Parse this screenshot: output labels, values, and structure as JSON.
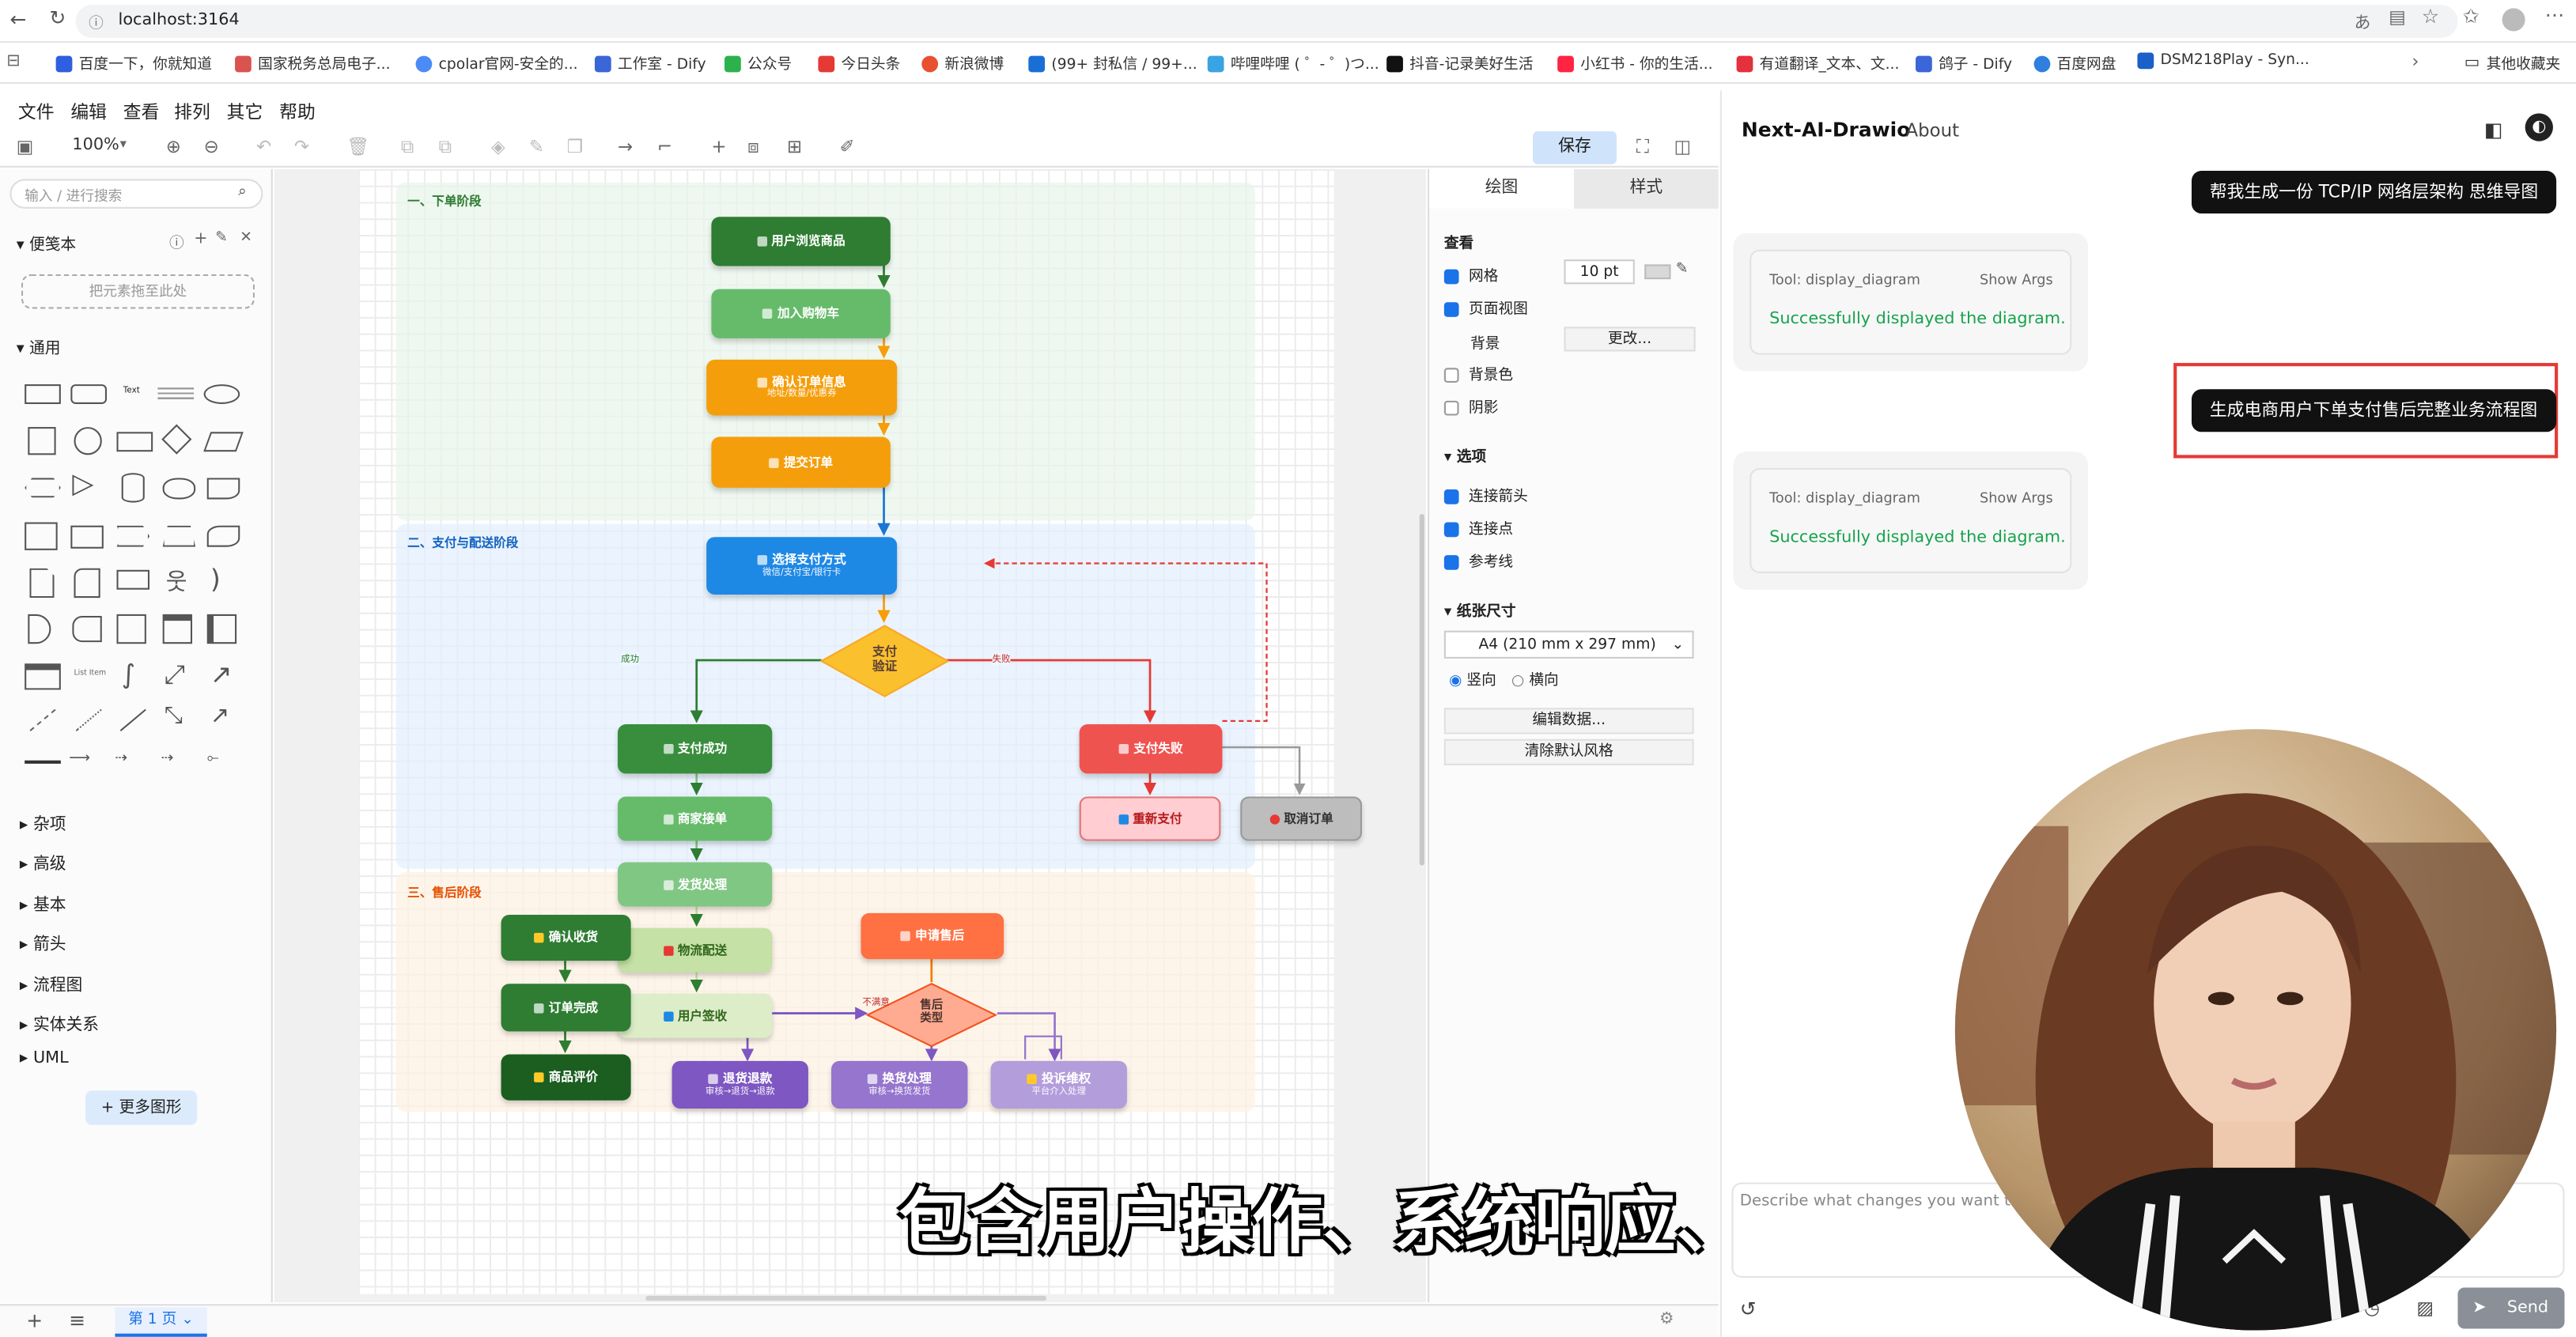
{
  "browser": {
    "url": "localhost:3164",
    "bookmarks": [
      "百度一下，你就知道",
      "国家税务总局电子...",
      "cpolar官网-安全的...",
      "工作室 - Dify",
      "公众号",
      "今日头条",
      "新浪微博",
      "(99+ 封私信 / 99+...",
      "哔哩哔哩 ( ゜- ゜)つ...",
      "抖音-记录美好生活",
      "小红书 - 你的生活...",
      "有道翻译_文本、文...",
      "鸽子 - Dify",
      "百度网盘",
      "DSM218Play - Syn..."
    ],
    "other_bookmarks": "其他收藏夹"
  },
  "menu": [
    "文件",
    "编辑",
    "查看",
    "排列",
    "其它",
    "帮助"
  ],
  "toolbar": {
    "zoom": "100%",
    "save": "保存"
  },
  "left": {
    "search_placeholder": "输入 / 进行搜索",
    "scratchpad": "便笺本",
    "drop_hint": "把元素拖至此处",
    "general": "通用",
    "sections": [
      "杂项",
      "高级",
      "基本",
      "箭头",
      "流程图",
      "实体关系",
      "UML"
    ],
    "more_shapes": "+ 更多图形"
  },
  "right": {
    "tabs": [
      "绘图",
      "样式"
    ],
    "view": "查看",
    "grid": "网格",
    "grid_size": "10 pt",
    "page_view": "页面视图",
    "background": "背景",
    "change": "更改...",
    "bg_color": "背景色",
    "shadow": "阴影",
    "options": "选项",
    "connection_arrows": "连接箭头",
    "connection_points": "连接点",
    "guides": "参考线",
    "paper_size": "纸张尺寸",
    "paper": "A4 (210 mm x 297 mm)",
    "portrait": "竖向",
    "landscape": "横向",
    "edit_data": "编辑数据...",
    "clear_style": "清除默认风格"
  },
  "bottom": {
    "page": "第 1 页"
  },
  "diagram": {
    "sec1": "一、下单阶段",
    "sec2": "二、支付与配送阶段",
    "sec3": "三、售后阶段",
    "browse": "用户浏览商品",
    "cart": "加入购物车",
    "confirm": "确认订单信息",
    "confirm_sub": "地址/数量/优惠券",
    "submit": "提交订单",
    "paymethod": "选择支付方式",
    "paymethod_sub": "微信/支付宝/银行卡",
    "payverify": "支付\n验证",
    "success_lbl": "成功",
    "fail_lbl": "失败",
    "pay_ok": "支付成功",
    "pay_fail": "支付失败",
    "repay": "重新支付",
    "cancel": "取消订单",
    "merchant": "商家接单",
    "ship": "发货处理",
    "logistics": "物流配送",
    "sign": "用户签收",
    "confirm_recv": "确认收货",
    "order_done": "订单完成",
    "review": "商品评价",
    "apply_as": "申请售后",
    "as_type": "售后\n类型",
    "unsatisfied": "不满意",
    "refund": "退货退款",
    "refund_sub": "审核→退货→退款",
    "exchange": "换货处理",
    "exchange_sub": "审核→换货发货",
    "complaint": "投诉维权",
    "complaint_sub": "平台介入处理"
  },
  "chat": {
    "title": "Next-AI-Drawio",
    "about": "About",
    "msg1": "帮我生成一份 TCP/IP 网络层架构 思维导图",
    "tool_name": "Tool: display_diagram",
    "show_args": "Show Args",
    "tool_result": "Successfully displayed the diagram.",
    "msg2": "生成电商用户下单支付售后完整业务流程图",
    "input_placeholder": "Describe what changes you want to make to the diagram. (Press Cmd/Ctrl + Enter to send)",
    "send": "Send"
  },
  "subtitle": "包含用户操作、系统响应、"
}
